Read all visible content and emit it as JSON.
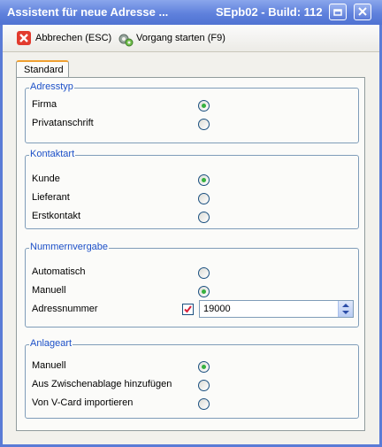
{
  "window": {
    "title": "Assistent für neue Adresse ...",
    "build_info": "SEpb02 - Build: 112"
  },
  "toolbar": {
    "cancel_label": "Abbrechen (ESC)",
    "start_label": "Vorgang starten (F9)"
  },
  "tabs": [
    {
      "label": "Standard",
      "active": true
    }
  ],
  "adresstyp": {
    "legend": "Adresstyp",
    "options": [
      {
        "label": "Firma",
        "selected": true
      },
      {
        "label": "Privatanschrift",
        "selected": false
      }
    ]
  },
  "kontaktart": {
    "legend": "Kontaktart",
    "options": [
      {
        "label": "Kunde",
        "selected": true
      },
      {
        "label": "Lieferant",
        "selected": false
      },
      {
        "label": "Erstkontakt",
        "selected": false
      }
    ]
  },
  "nummernvergabe": {
    "legend": "Nummernvergabe",
    "options": [
      {
        "label": "Automatisch",
        "selected": false
      },
      {
        "label": "Manuell",
        "selected": true
      }
    ],
    "adressnummer_label": "Adressnummer",
    "adressnummer_checked": true,
    "adressnummer_value": "19000"
  },
  "anlageart": {
    "legend": "Anlageart",
    "options": [
      {
        "label": "Manuell",
        "selected": true
      },
      {
        "label": "Aus Zwischenablage hinzufügen",
        "selected": false
      },
      {
        "label": "Von V-Card importieren",
        "selected": false
      }
    ]
  },
  "colors": {
    "titlebar": "#5f81dc",
    "legend_text": "#1c50c8",
    "radio_selected": "#36b13f",
    "tab_accent": "#f0a030"
  }
}
